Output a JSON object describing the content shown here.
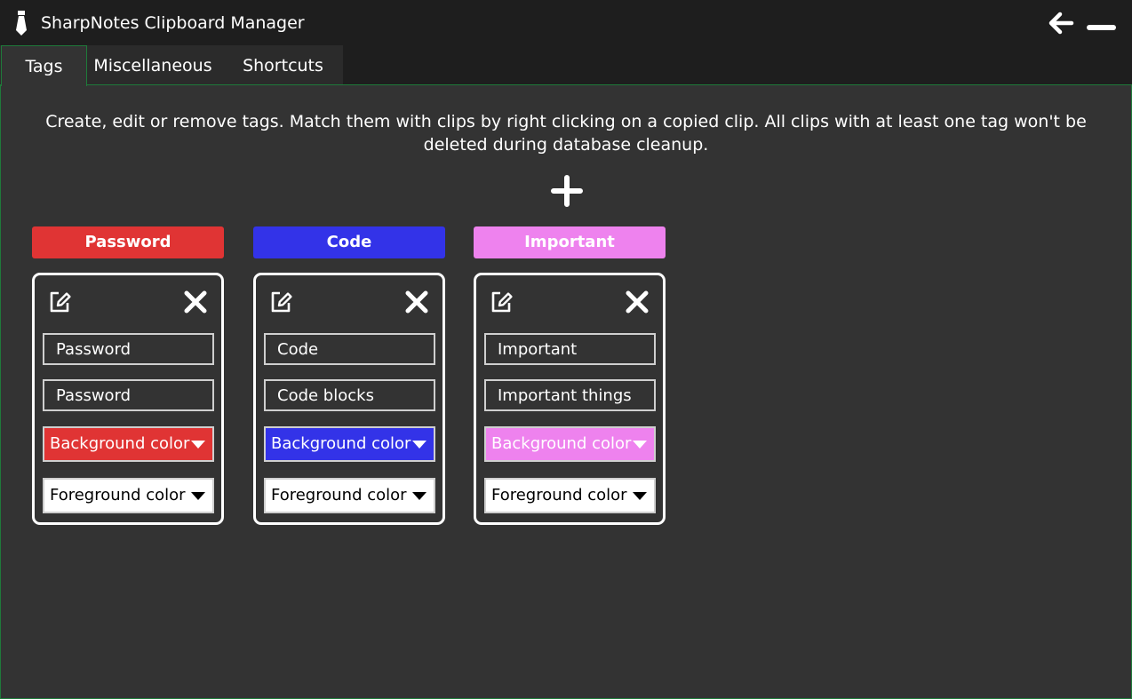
{
  "app": {
    "title": "SharpNotes Clipboard Manager"
  },
  "tabs": [
    {
      "label": "Tags",
      "active": true
    },
    {
      "label": "Miscellaneous",
      "active": false
    },
    {
      "label": "Shortcuts",
      "active": false
    }
  ],
  "main": {
    "description": "Create, edit or remove tags. Match them with clips by right clicking on a copied clip. All clips with at least one tag won't be deleted during database cleanup."
  },
  "icons": {
    "app": "tie-icon",
    "back": "arrow-left-icon",
    "minimize": "minimize-icon",
    "add": "plus-icon",
    "edit": "edit-icon",
    "delete": "close-icon",
    "dropdown": "caret-down-icon"
  },
  "colors": {
    "panel": "#333333",
    "titlebar": "#1e1e1e",
    "tab_border": "#1f7a3a"
  },
  "tags": [
    {
      "header": "Password",
      "name": "Password",
      "description": "Password",
      "background_label": "Background color",
      "foreground_label": "Foreground color",
      "color": "#e03434"
    },
    {
      "header": "Code",
      "name": "Code",
      "description": "Code blocks",
      "background_label": "Background color",
      "foreground_label": "Foreground color",
      "color": "#3333e8"
    },
    {
      "header": "Important",
      "name": "Important",
      "description": "Important things",
      "background_label": "Background color",
      "foreground_label": "Foreground color",
      "color": "#ee82ee"
    }
  ]
}
